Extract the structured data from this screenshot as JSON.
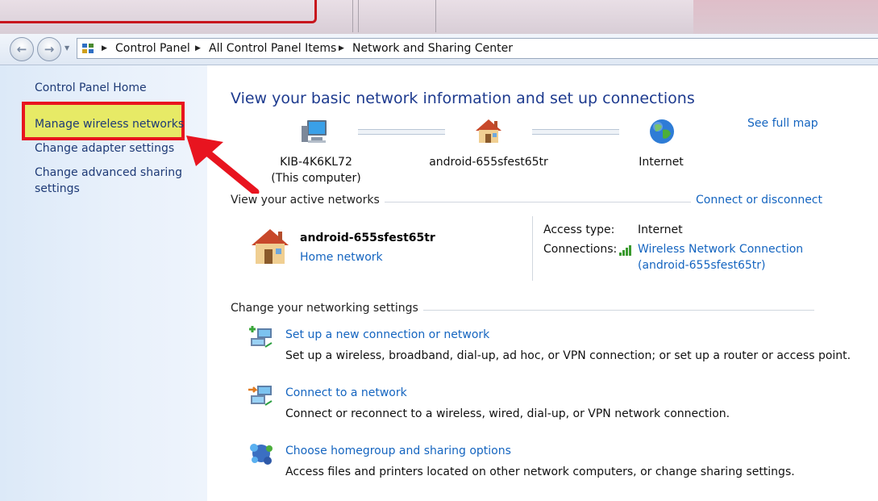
{
  "breadcrumb": {
    "items": [
      "Control Panel",
      "All Control Panel Items",
      "Network and Sharing Center"
    ]
  },
  "left_pane": {
    "links": [
      "Control Panel Home",
      "Manage wireless networks",
      "Change adapter settings",
      "Change advanced sharing",
      "settings"
    ]
  },
  "main": {
    "title": "View your basic network information and set up connections",
    "see_full_map": "See full map",
    "map": {
      "computer_name": "KIB-4K6KL72",
      "computer_note": "(This computer)",
      "network_name": "android-655sfest65tr",
      "internet": "Internet"
    },
    "active_networks": {
      "heading": "View your active networks",
      "connect_link": "Connect or disconnect",
      "name": "android-655sfest65tr",
      "type_link": "Home network",
      "access_type_label": "Access type:",
      "access_type_value": "Internet",
      "connections_label": "Connections:",
      "connection_link_line1": "Wireless Network Connection",
      "connection_link_line2": "(android-655sfest65tr)"
    },
    "settings": {
      "heading": "Change your networking settings",
      "tasks": [
        {
          "title": "Set up a new connection or network",
          "desc": "Set up a wireless, broadband, dial-up, ad hoc, or VPN connection; or set up a router or access point.",
          "icon": "new-connection-icon"
        },
        {
          "title": "Connect to a network",
          "desc": "Connect or reconnect to a wireless, wired, dial-up, or VPN network connection.",
          "icon": "connect-network-icon"
        },
        {
          "title": "Choose homegroup and sharing options",
          "desc": "Access files and printers located on other network computers, or change sharing settings.",
          "icon": "homegroup-icon"
        }
      ]
    }
  },
  "colors": {
    "link": "#1565c0",
    "title": "#1e3b8f",
    "highlight_fill": "#e7ea66",
    "annotation_red": "#e8141f"
  }
}
